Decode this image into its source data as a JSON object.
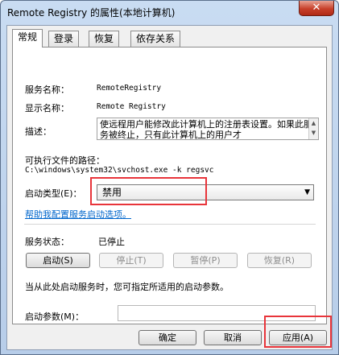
{
  "window": {
    "title": "Remote Registry 的属性(本地计算机)",
    "close_glyph": "✕"
  },
  "tabs": [
    "常规",
    "登录",
    "恢复",
    "依存关系"
  ],
  "general": {
    "service_name_label": "服务名称：",
    "service_name_value": "RemoteRegistry",
    "display_name_label": "显示名称：",
    "display_name_value": "Remote Registry",
    "description_label": "描述：",
    "description_text": "使远程用户能修改此计算机上的注册表设置。如果此服务被终止，只有此计算机上的用户才",
    "exe_path_label": "可执行文件的路径：",
    "exe_path_value": "C:\\windows\\system32\\svchost.exe -k regsvc",
    "startup_type_label": "启动类型(E)：",
    "startup_type_value": "禁用",
    "help_link": "帮助我配置服务启动选项。",
    "service_status_label": "服务状态：",
    "service_status_value": "已停止",
    "buttons": {
      "start": "启动(S)",
      "stop": "停止(T)",
      "pause": "暂停(P)",
      "resume": "恢复(R)"
    },
    "hint": "当从此处启动服务时，您可指定所适用的启动参数。",
    "start_params_label": "启动参数(M)：",
    "start_params_value": ""
  },
  "footer": {
    "ok": "确定",
    "cancel": "取消",
    "apply": "应用(A)"
  },
  "colors": {
    "highlight_box": "#e8343a",
    "link": "#0066cc",
    "close_button": "#c7402a"
  }
}
